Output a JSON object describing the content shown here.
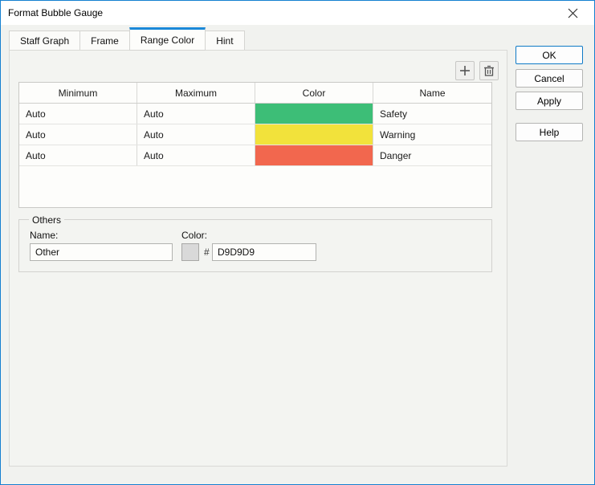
{
  "window": {
    "title": "Format Bubble Gauge"
  },
  "tabs": [
    {
      "label": "Staff Graph",
      "active": false
    },
    {
      "label": "Frame",
      "active": false
    },
    {
      "label": "Range Color",
      "active": true
    },
    {
      "label": "Hint",
      "active": false
    }
  ],
  "table": {
    "headers": [
      "Minimum",
      "Maximum",
      "Color",
      "Name"
    ],
    "rows": [
      {
        "minimum": "Auto",
        "maximum": "Auto",
        "color": "#3DBE77",
        "name": "Safety"
      },
      {
        "minimum": "Auto",
        "maximum": "Auto",
        "color": "#F2E23B",
        "name": "Warning"
      },
      {
        "minimum": "Auto",
        "maximum": "Auto",
        "color": "#F2674E",
        "name": "Danger"
      }
    ]
  },
  "others": {
    "legend": "Others",
    "name_label": "Name:",
    "name_value": "Other",
    "color_label": "Color:",
    "hash": "#",
    "color_value": "D9D9D9",
    "swatch_color": "#D9D9D9"
  },
  "buttons": {
    "ok": "OK",
    "cancel": "Cancel",
    "apply": "Apply",
    "help": "Help"
  },
  "colors": {
    "accent": "#1B88D8"
  }
}
